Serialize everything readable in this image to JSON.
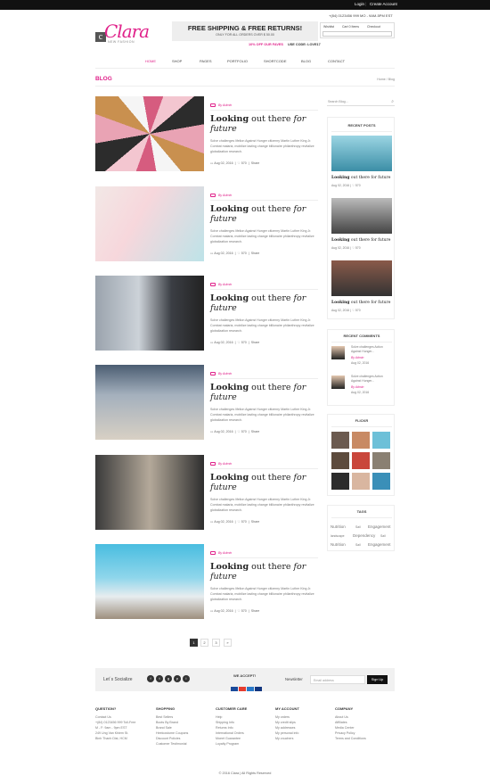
{
  "topbar": {
    "login": "Login",
    "create": "Create Account"
  },
  "contact": "+(84) 0123456 999  MO - 9AM-5PM EST",
  "logo": {
    "script": "Clara",
    "tagline": "NEW FASHION"
  },
  "promo": {
    "headline": "FREE SHIPPING & FREE RETURNS!",
    "sub": "ONLY FOR ALL ORDERS OVER $ 50.00"
  },
  "mini": {
    "wishlist": "Wishlist",
    "cart": "Cart 0 Items",
    "checkout": "Checkout"
  },
  "offer": {
    "sale": "10% OFF OUR FAVES",
    "code": "USE CODE: LOVE17"
  },
  "nav": [
    "HOME",
    "SHOP",
    "PAGES",
    "PORTFOLIO",
    "SHORTCODE",
    "BLOG",
    "CONTACT"
  ],
  "page": {
    "title": "BLOG",
    "breadcrumb": "Home  /  Blog"
  },
  "posts": [
    {
      "author": "By Admin",
      "t1": "Looking",
      "t2": " out there ",
      "t3": "for future",
      "excerpt": "Solve challenges lifelion Against Hunger citizenry Martin Luther King Jr. Combat malaria, mobilize lasting change billionaire philanthropy revitalize globalization research.",
      "date": "Aug 02, 2016",
      "likes": "570",
      "share": "Share"
    },
    {
      "author": "By Admin",
      "t1": "Looking",
      "t2": " out there ",
      "t3": "for future",
      "excerpt": "Solve challenges lifelion Against Hunger citizenry Martin Luther King Jr. Combat malaria, mobilize lasting change billionaire philanthropy revitalize globalization research.",
      "date": "Aug 02, 2016",
      "likes": "570",
      "share": "Share"
    },
    {
      "author": "By Admin",
      "t1": "Looking",
      "t2": " out there ",
      "t3": "for future",
      "excerpt": "Solve challenges lifelion Against Hunger citizenry Martin Luther King Jr. Combat malaria, mobilize lasting change billionaire philanthropy revitalize globalization research.",
      "date": "Aug 02, 2016",
      "likes": "570",
      "share": "Share"
    },
    {
      "author": "By Admin",
      "t1": "Looking",
      "t2": " out there ",
      "t3": "for future",
      "excerpt": "Solve challenges lifelion Against Hunger citizenry Martin Luther King Jr. Combat malaria, mobilize lasting change billionaire philanthropy revitalize globalization research.",
      "date": "Aug 02, 2016",
      "likes": "570",
      "share": "Share"
    },
    {
      "author": "By Admin",
      "t1": "Looking",
      "t2": " out there ",
      "t3": "for future",
      "excerpt": "Solve challenges lifelion Against Hunger citizenry Martin Luther King Jr. Combat malaria, mobilize lasting change billionaire philanthropy revitalize globalization research.",
      "date": "Aug 02, 2016",
      "likes": "570",
      "share": "Share"
    },
    {
      "author": "By Admin",
      "t1": "Looking",
      "t2": " out there ",
      "t3": "for future",
      "excerpt": "Solve challenges lifelion Against Hunger citizenry Martin Luther King Jr. Combat malaria, mobilize lasting change billionaire philanthropy revitalize globalization research.",
      "date": "Aug 02, 2016",
      "likes": "570",
      "share": "Share"
    }
  ],
  "sidebar": {
    "search_placeholder": "Search Blog...",
    "recent_title": "RECENT POSTS",
    "recent": [
      {
        "t1": "Looking",
        "t2": " out there for future",
        "meta": "Aug 02, 2016  |  ♡ 570"
      },
      {
        "t1": "Looking",
        "t2": " out there for future",
        "meta": "Aug 02, 2016  |  ♡ 570"
      },
      {
        "t1": "Looking",
        "t2": " out there for future",
        "meta": "Aug 02, 2016  |  ♡ 570"
      }
    ],
    "comments_title": "RECENT COMMENTS",
    "comments": [
      {
        "text": "Solve challenges Action Against Hunger...",
        "author": "By Admin",
        "date": "Aug 02, 2016"
      },
      {
        "text": "Solve challenges Action Against Hunger...",
        "author": "By Admin",
        "date": "Aug 02, 2016"
      }
    ],
    "flickr_title": "FLICKR",
    "tags_title": "TAGS",
    "tags": [
      "Nutrition",
      "Sail",
      "Engagement",
      "landscape",
      "Dependency",
      "Sail",
      "Nutrition",
      "Sail",
      "Engagement"
    ]
  },
  "pagination": [
    "1",
    "2",
    "3",
    "»"
  ],
  "social": {
    "label": "Let´s Socialize",
    "icons": [
      "f",
      "t",
      "g",
      "p",
      "i"
    ],
    "accept": "WE ACCEPT!",
    "newsletter": "Newsletter",
    "email_placeholder": "Email address",
    "signup": "Sign Up"
  },
  "footer": [
    {
      "title": "QUESTION?",
      "items": [
        "Contact Us",
        "+(84) 0123456 999 Toll-Free",
        "M - F: 9am - 9pm EST",
        "249 Ung Van Khiem St.",
        "Binh Thanh Dist, HCM"
      ]
    },
    {
      "title": "SHOPPING",
      "items": [
        "Best Sellers",
        "Boots By Brand",
        "Brand Sale",
        "Heelcostume Coupons",
        "Discount Policies",
        "Customer Testimonial"
      ]
    },
    {
      "title": "CUSTOMER CARE",
      "items": [
        "Help",
        "Shipping Info",
        "Returns Info",
        "International Orders",
        "Moeet Guarantee",
        "Loyalty Program"
      ]
    },
    {
      "title": "MY ACCOUNT",
      "items": [
        "My orders",
        "My credit slips",
        "My addresses",
        "My personal info",
        "My vouchers"
      ]
    },
    {
      "title": "COMPANY",
      "items": [
        "About Us",
        "Affiliates",
        "Media Center",
        "Privacy Policy",
        "Terms and Conditions"
      ]
    }
  ],
  "copyright": "© 2016 Clara  |  All Rights Reserved",
  "colors": {
    "accent": "#e0218a",
    "dark": "#111111"
  }
}
